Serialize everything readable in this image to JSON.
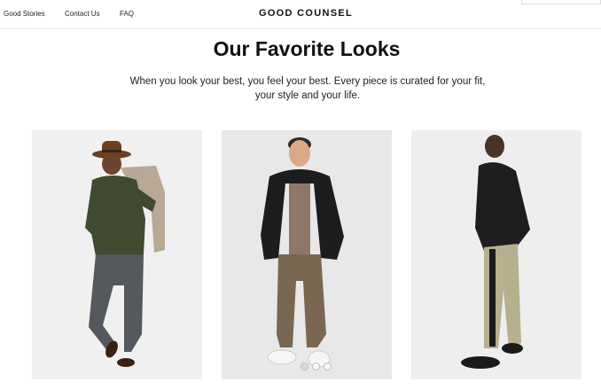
{
  "nav": {
    "links": [
      "Good Stories",
      "Contact Us",
      "FAQ"
    ],
    "brand": "GOOD COUNSEL"
  },
  "hero": {
    "title": "Our Favorite Looks",
    "subtitle": "When you look your best, you feel your best. Every piece is curated for your fit, your style and your life."
  },
  "looks": [
    {
      "name": "look-1",
      "description": "olive shirt, grey trousers, brown fedora"
    },
    {
      "name": "look-2",
      "description": "black bomber jacket, olive joggers"
    },
    {
      "name": "look-3",
      "description": "black sweater, khaki striped trousers"
    }
  ],
  "carousel": {
    "count": 3,
    "active": 0
  },
  "colors": {
    "background": "#ffffff",
    "text": "#111111",
    "photo_bg": "#e7e7e7"
  }
}
